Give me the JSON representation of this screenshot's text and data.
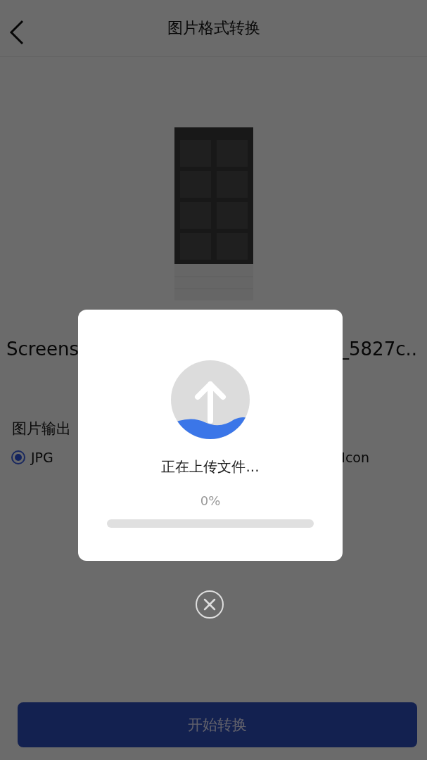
{
  "header": {
    "title": "图片格式转换"
  },
  "file": {
    "name_start": "Screens",
    "name_end": "_5827c.."
  },
  "output": {
    "label": "图片输出",
    "options": [
      {
        "label": "JPG",
        "selected": true
      },
      {
        "label": "Icon"
      }
    ]
  },
  "start_button": {
    "label": "开始转换"
  },
  "dialog": {
    "message": "正在上传文件...",
    "percent": "0%",
    "level": 0
  }
}
